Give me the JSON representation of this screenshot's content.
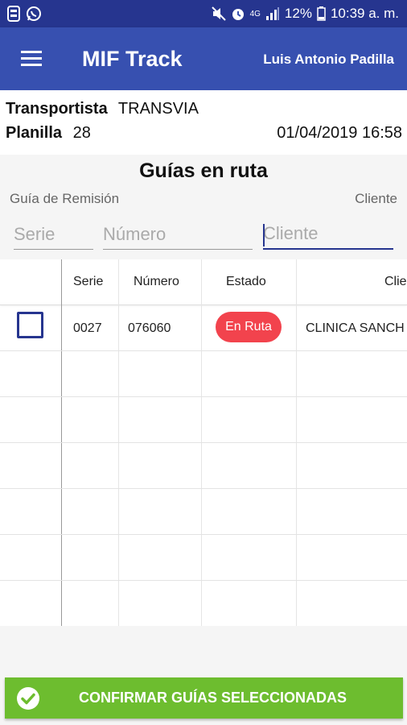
{
  "status_bar": {
    "battery": "12%",
    "time": "10:39 a. m.",
    "network": "4G",
    "icons": [
      "sim-icon",
      "whatsapp-icon",
      "mute-icon",
      "alarm-icon",
      "signal-icon",
      "battery-icon"
    ]
  },
  "app_bar": {
    "title": "MIF Track",
    "user": "Luis Antonio Padilla",
    "color": "#3750b0"
  },
  "info": {
    "transportista_label": "Transportista",
    "transportista_value": "TRANSVIA",
    "planilla_label": "Planilla",
    "planilla_value": "28",
    "datetime": "01/04/2019 16:58"
  },
  "section": {
    "title": "Guías en ruta",
    "guia_label": "Guía de Remisión",
    "cliente_label": "Cliente"
  },
  "filters": {
    "serie_placeholder": "Serie",
    "numero_placeholder": "Número",
    "cliente_placeholder": "Cliente"
  },
  "table": {
    "headers": [
      "Serie",
      "Número",
      "Estado",
      "Clie"
    ],
    "rows": [
      {
        "serie": "0027",
        "numero": "076060",
        "estado": "En Ruta",
        "cliente": "CLINICA SANCH",
        "checked": false
      }
    ],
    "badge_color": "#f2434d"
  },
  "confirm_button": {
    "label": "CONFIRMAR GUÍAS SELECCIONADAS",
    "color": "#6dbd2f"
  }
}
